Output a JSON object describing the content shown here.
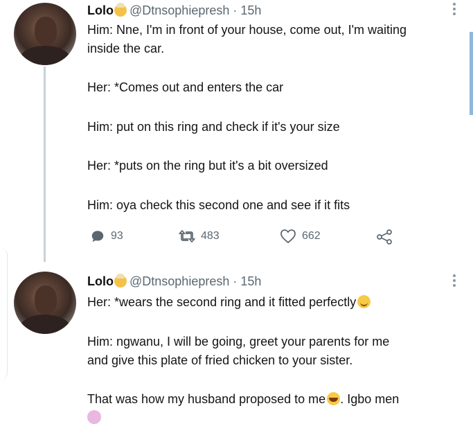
{
  "tweets": [
    {
      "name": "Lolo",
      "handle": "@Dtnsophiepresh",
      "dot": "·",
      "time": "15h",
      "lines": [
        "Him: Nne, I'm in front of your house, come out, I'm waiting",
        "inside the car.",
        "Her: *Comes out and enters the car",
        "Him: put on this ring and check if it's your size",
        "Her: *puts on the ring but it's a bit oversized",
        "Him: oya check this second one and see if it fits"
      ],
      "actions": {
        "replies": "93",
        "retweets": "483",
        "likes": "662"
      }
    },
    {
      "name": "Lolo",
      "handle": "@Dtnsophiepresh",
      "dot": "·",
      "time": "15h",
      "lines": [
        "Her: *wears the second ring and it fitted perfectly",
        "Him: ngwanu, I will be going, greet your parents for me",
        "and give this plate of fried chicken to your sister.",
        "That was how my husband proposed to me",
        ". Igbo men"
      ]
    }
  ],
  "icons": {
    "reply": "reply-icon",
    "retweet": "retweet-icon",
    "like": "heart-icon",
    "share": "share-icon",
    "more": "more-options-icon"
  },
  "colors": {
    "text": "#141414",
    "muted": "#5b6770",
    "accent_bar": "#8fb8de"
  }
}
